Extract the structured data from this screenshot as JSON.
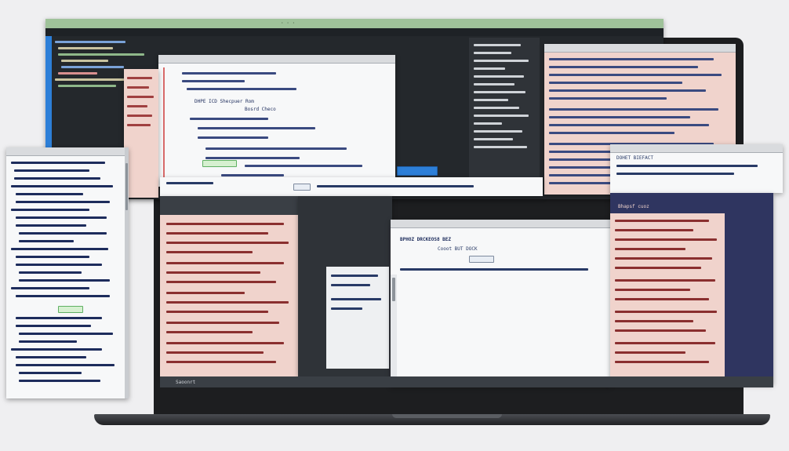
{
  "colors": {
    "background": "#efeff1",
    "laptop_frame": "#1d1e20",
    "terminal_bg": "#24282c",
    "editor_bg": "#2f3338",
    "pink_doc": "#f0d3cc",
    "white_doc": "#f7f8f9",
    "navy_panel": "#2f3560",
    "accent_blue": "#2d7fd8",
    "accent_green": "#5fb063"
  },
  "laptop": {
    "name": "laptop-screen"
  },
  "texts": {
    "dialog_top": "DHPE ICD Shecpuer Rom",
    "dialog_top2": "Bosrd Checo",
    "center_dialog_title": "BPHOZ DRCKEOS8 BEZ",
    "center_dialog_sub": "Cooot BUT DOCK",
    "right_dialog_tab": "Bhapsf cuoz",
    "bottom_bar_label": "Saoonrt",
    "sheet_label": "DOHET BIEFACT"
  }
}
